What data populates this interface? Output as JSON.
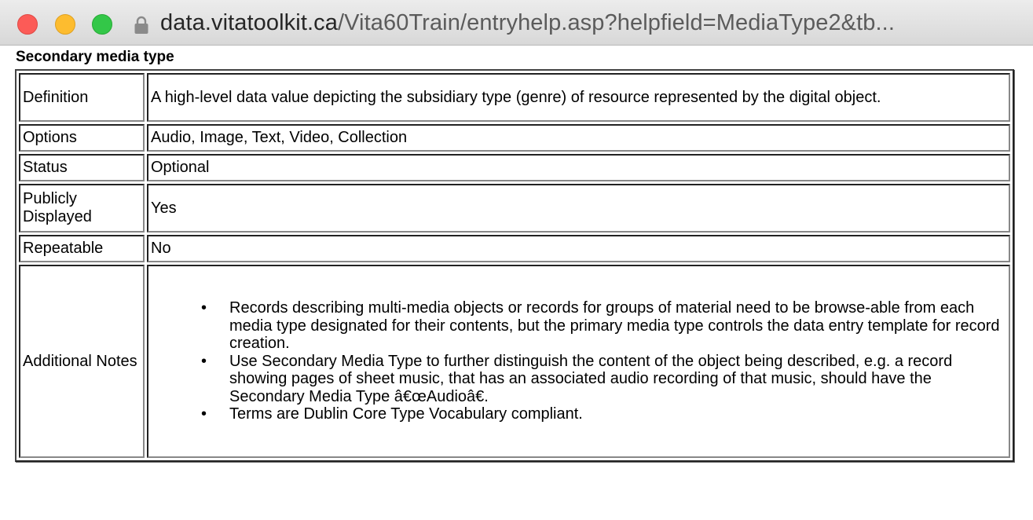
{
  "browser": {
    "url_host": "data.vitatoolkit.ca",
    "url_path": "/Vita60Train/entryhelp.asp?helpfield=MediaType2&tb..."
  },
  "page": {
    "title": "Secondary media type"
  },
  "rows": {
    "definition": {
      "label": "Definition",
      "value": "A high-level data value depicting the subsidiary type (genre) of resource represented by the digital object."
    },
    "options": {
      "label": "Options",
      "value": "Audio, Image, Text, Video, Collection"
    },
    "status": {
      "label": "Status",
      "value": "Optional"
    },
    "publicly_displayed": {
      "label": "Publicly Displayed",
      "value": "Yes"
    },
    "repeatable": {
      "label": "Repeatable",
      "value": "No"
    },
    "additional_notes": {
      "label": "Additional Notes",
      "bullet": "•",
      "items": [
        "Records describing multi-media objects or records for groups of material need to be browse-able from each media type designated for their contents, but the primary media type controls the data entry template for record creation.",
        "Use Secondary Media Type to further distinguish the content of the object being described, e.g. a record showing pages of sheet music, that has an associated audio recording of that music, should have the Secondary Media Type â€œAudioâ€.",
        "Terms are Dublin Core Type Vocabulary compliant."
      ]
    }
  },
  "colors": {
    "close": "#fc5b57",
    "minimize": "#fdbc2f",
    "zoom": "#33c748"
  },
  "icons": {
    "lock": "lock-icon"
  }
}
